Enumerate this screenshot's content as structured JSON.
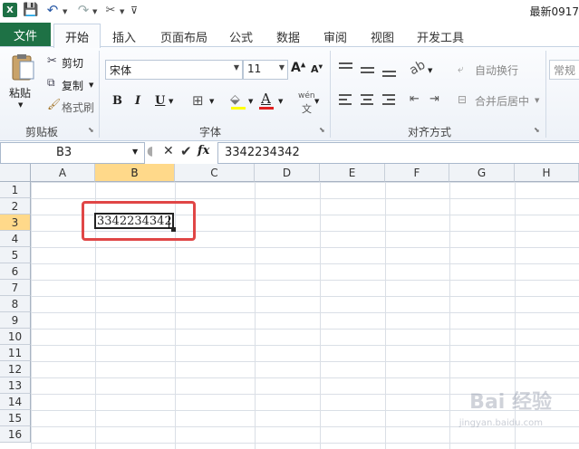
{
  "title_bar": {
    "doc_title": "最新0917",
    "icons": [
      "excel-logo-icon",
      "save-icon",
      "undo-icon",
      "redo-icon",
      "tools-icon",
      "customize-qat-icon"
    ]
  },
  "tabs": {
    "file": "文件",
    "home": "开始",
    "insert": "插入",
    "page_layout": "页面布局",
    "formulas": "公式",
    "data": "数据",
    "review": "审阅",
    "view": "视图",
    "developer": "开发工具"
  },
  "ribbon": {
    "clipboard": {
      "paste": "粘贴",
      "cut": "剪切",
      "copy": "复制",
      "format_painter": "格式刷",
      "label": "剪贴板"
    },
    "font": {
      "font_name": "宋体",
      "font_size": "11",
      "bold": "B",
      "italic": "I",
      "underline": "U",
      "font_color_letter": "A",
      "phonetic": "wén",
      "label": "字体"
    },
    "alignment": {
      "wrap_text": "自动换行",
      "merge_center": "合并后居中",
      "label": "对齐方式"
    },
    "number": {
      "format": "常规"
    },
    "colors": {
      "file_tab": "#1e7145",
      "font_color_bar": "#e02020",
      "selected_header": "#ffd98a",
      "highlight_box": "#e04646"
    }
  },
  "formula_bar": {
    "name_box": "B3",
    "formula_value": "3342234342"
  },
  "grid": {
    "columns": [
      "A",
      "B",
      "C",
      "D",
      "E",
      "F",
      "G",
      "H"
    ],
    "rows": [
      "1",
      "2",
      "3",
      "4",
      "5",
      "6",
      "7",
      "8",
      "9",
      "10",
      "11",
      "12",
      "13",
      "14",
      "15",
      "16"
    ],
    "active_cell": "B3",
    "active_cell_value": "3342234342"
  },
  "watermark": {
    "brand": "Bai 经验",
    "sub": "jingyan.baidu.com"
  }
}
